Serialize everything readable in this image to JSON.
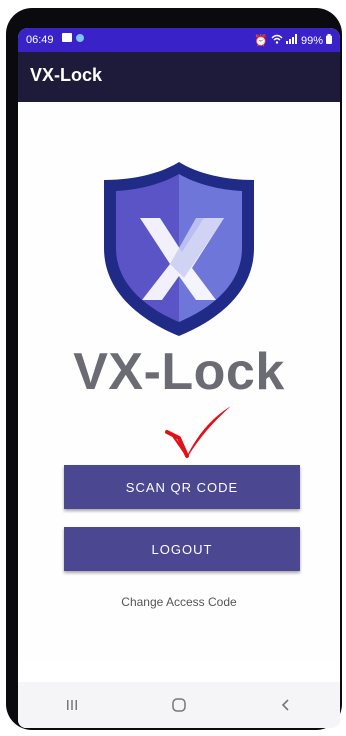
{
  "status_bar": {
    "time": "06:49",
    "battery": "99%",
    "icons": [
      "image-icon",
      "notification-dot-icon",
      "alarm-icon",
      "wifi-icon",
      "signal-icon",
      "battery-icon"
    ]
  },
  "app_bar": {
    "title": "VX-Lock"
  },
  "logo": {
    "icon": "vx-lock-shield-logo",
    "colors": {
      "outer": "#1f2b86",
      "inner_left": "#5a54c6",
      "inner_right": "#6f76d9",
      "mark": "#ffffff"
    }
  },
  "brand_text": "VX-Lock",
  "annotation": {
    "icon": "red-checkmark-icon",
    "color": "#e3101a"
  },
  "buttons": {
    "scan_label": "SCAN QR CODE",
    "logout_label": "LOGOUT"
  },
  "links": {
    "change_access_code": "Change Access Code"
  },
  "nav_bar": {
    "items": [
      "recent-apps-icon",
      "home-icon",
      "back-icon"
    ]
  },
  "colors": {
    "status_bar": "#3a22c9",
    "app_bar": "#1e1b3a",
    "button": "#4b4790",
    "brand_text": "#6b6b73"
  }
}
